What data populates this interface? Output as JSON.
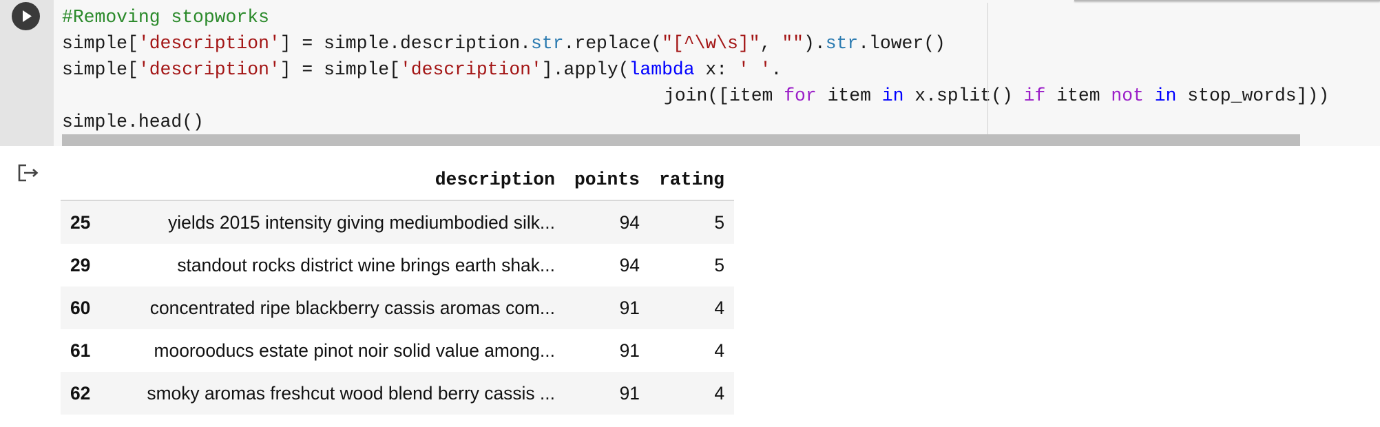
{
  "cell": {
    "run_icon": "play-icon",
    "code_lines": [
      "#Removing stopworks",
      "simple['description'] = simple.description.str.replace(\"[^\\w\\s]\", \"\").str.lower()",
      "simple['description'] = simple['description'].apply(lambda x: ' '.",
      "join([item for item in x.split() if item not in stop_words]))",
      "simple.head()"
    ]
  },
  "output": {
    "icon": "output-redirect-icon",
    "table": {
      "columns": [
        "description",
        "points",
        "rating"
      ],
      "rows": [
        {
          "index": "25",
          "description": "yields 2015 intensity giving mediumbodied silk...",
          "points": "94",
          "rating": "5"
        },
        {
          "index": "29",
          "description": "standout rocks district wine brings earth shak...",
          "points": "94",
          "rating": "5"
        },
        {
          "index": "60",
          "description": "concentrated ripe blackberry cassis aromas com...",
          "points": "91",
          "rating": "4"
        },
        {
          "index": "61",
          "description": "moorooducs estate pinot noir solid value among...",
          "points": "91",
          "rating": "4"
        },
        {
          "index": "62",
          "description": "smoky aromas freshcut wood blend berry cassis ...",
          "points": "91",
          "rating": "4"
        }
      ]
    }
  },
  "colors": {
    "comment": "#2b8a2b",
    "string": "#a31515",
    "attribute": "#2a7ab0",
    "keyword": "#0000ff",
    "control_keyword": "#9b1ec8"
  }
}
